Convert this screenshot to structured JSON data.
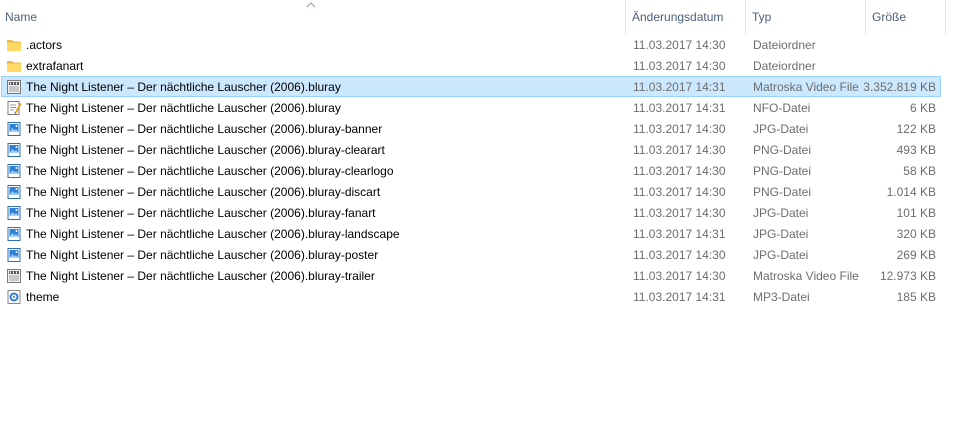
{
  "columns": {
    "name": "Name",
    "date": "Änderungsdatum",
    "type": "Typ",
    "size": "Größe"
  },
  "files": [
    {
      "name": ".actors",
      "date": "11.03.2017 14:30",
      "type": "Dateiordner",
      "size": "",
      "icon": "folder-icon"
    },
    {
      "name": "extrafanart",
      "date": "11.03.2017 14:30",
      "type": "Dateiordner",
      "size": "",
      "icon": "folder-icon"
    },
    {
      "name": "The Night Listener – Der nächtliche Lauscher (2006).bluray",
      "date": "11.03.2017 14:31",
      "type": "Matroska Video File",
      "size": "3.352.819 KB",
      "icon": "video-file-icon",
      "selected": true
    },
    {
      "name": "The Night Listener – Der nächtliche Lauscher (2006).bluray",
      "date": "11.03.2017 14:31",
      "type": "NFO-Datei",
      "size": "6 KB",
      "icon": "nfo-file-icon"
    },
    {
      "name": "The Night Listener – Der nächtliche Lauscher (2006).bluray-banner",
      "date": "11.03.2017 14:30",
      "type": "JPG-Datei",
      "size": "122 KB",
      "icon": "image-file-icon"
    },
    {
      "name": "The Night Listener – Der nächtliche Lauscher (2006).bluray-clearart",
      "date": "11.03.2017 14:30",
      "type": "PNG-Datei",
      "size": "493 KB",
      "icon": "image-file-icon"
    },
    {
      "name": "The Night Listener – Der nächtliche Lauscher (2006).bluray-clearlogo",
      "date": "11.03.2017 14:30",
      "type": "PNG-Datei",
      "size": "58 KB",
      "icon": "image-file-icon"
    },
    {
      "name": "The Night Listener – Der nächtliche Lauscher (2006).bluray-discart",
      "date": "11.03.2017 14:30",
      "type": "PNG-Datei",
      "size": "1.014 KB",
      "icon": "image-file-icon"
    },
    {
      "name": "The Night Listener – Der nächtliche Lauscher (2006).bluray-fanart",
      "date": "11.03.2017 14:30",
      "type": "JPG-Datei",
      "size": "101 KB",
      "icon": "image-file-icon"
    },
    {
      "name": "The Night Listener – Der nächtliche Lauscher (2006).bluray-landscape",
      "date": "11.03.2017 14:31",
      "type": "JPG-Datei",
      "size": "320 KB",
      "icon": "image-file-icon"
    },
    {
      "name": "The Night Listener – Der nächtliche Lauscher (2006).bluray-poster",
      "date": "11.03.2017 14:30",
      "type": "JPG-Datei",
      "size": "269 KB",
      "icon": "image-file-icon"
    },
    {
      "name": "The Night Listener – Der nächtliche Lauscher (2006).bluray-trailer",
      "date": "11.03.2017 14:30",
      "type": "Matroska Video File",
      "size": "12.973 KB",
      "icon": "video-file-icon"
    },
    {
      "name": "theme",
      "date": "11.03.2017 14:31",
      "type": "MP3-Datei",
      "size": "185 KB",
      "icon": "audio-file-icon"
    }
  ],
  "colors": {
    "header_text": "#4c607a",
    "detail_text": "#6d6d6d",
    "selection_bg": "#cce8ff",
    "selection_border": "#99d1ff",
    "folder": "#ffd866"
  }
}
